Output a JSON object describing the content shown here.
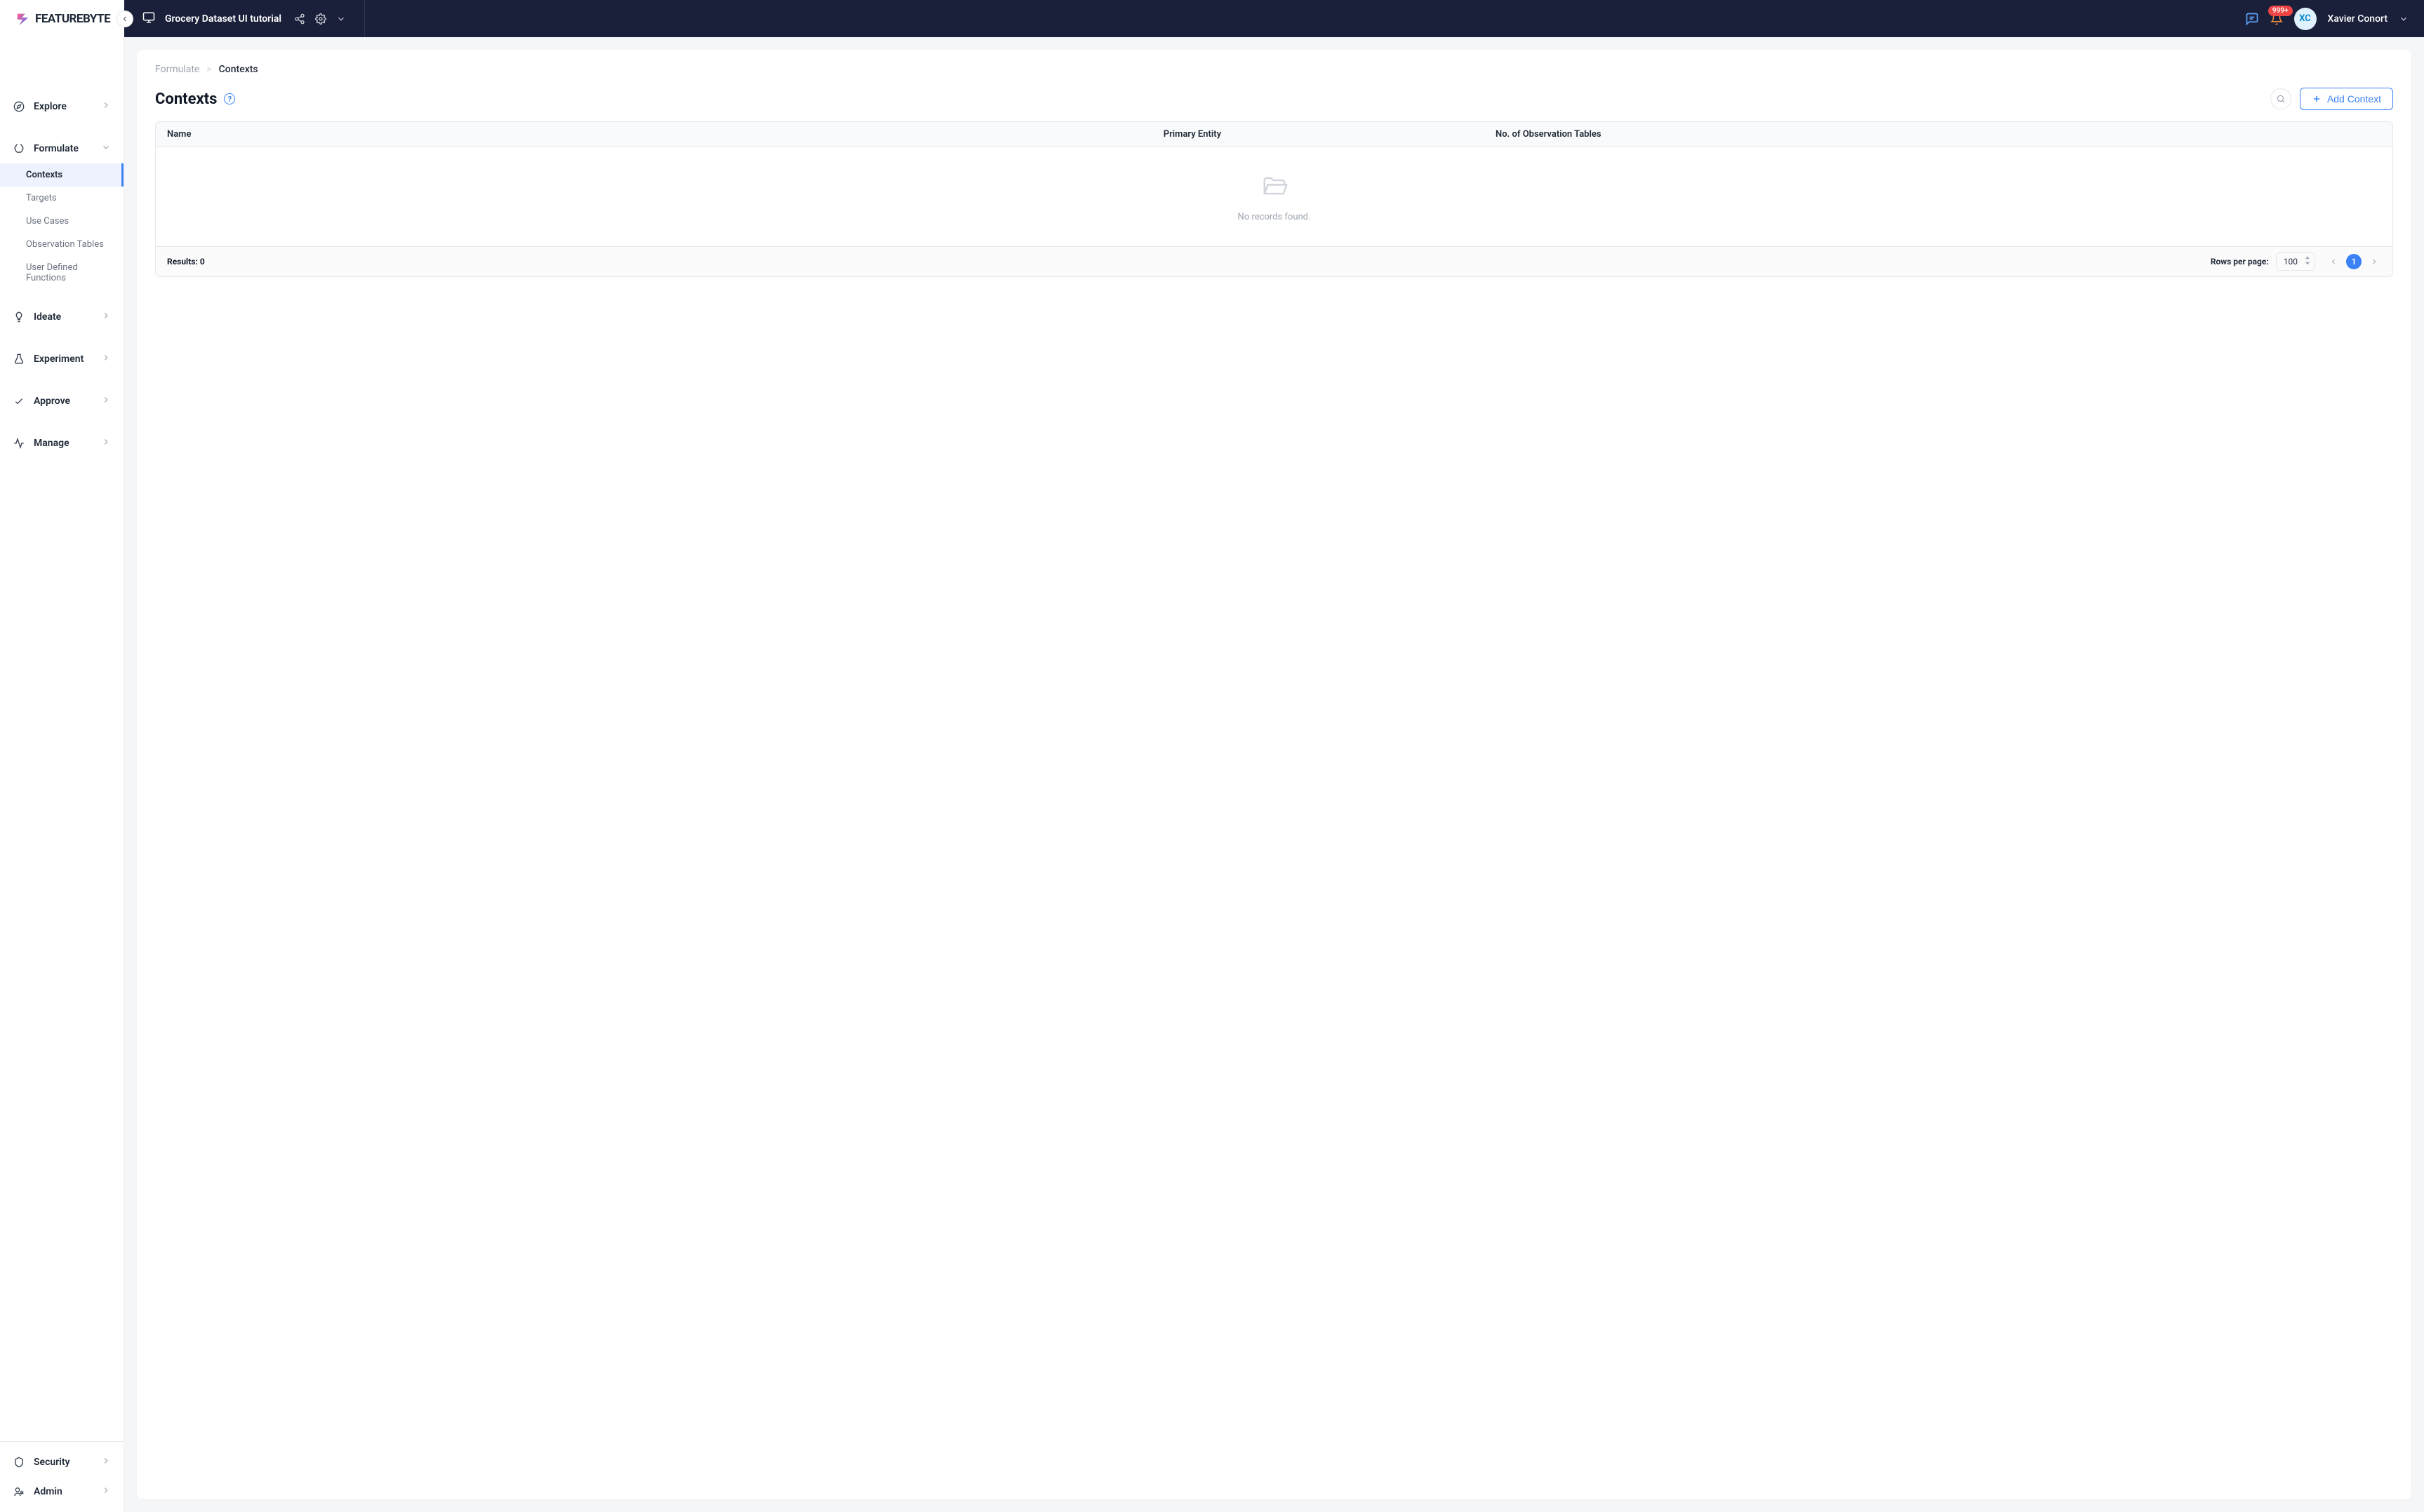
{
  "brand": "FEATUREBYTE",
  "header": {
    "project_name": "Grocery Dataset UI tutorial",
    "notif_badge": "999+",
    "avatar_initials": "XC",
    "user_name": "Xavier Conort"
  },
  "sidebar": {
    "main": [
      {
        "label": "Explore",
        "icon": "compass"
      },
      {
        "label": "Formulate",
        "icon": "brain",
        "expanded": true,
        "children": [
          {
            "label": "Contexts",
            "active": true
          },
          {
            "label": "Targets"
          },
          {
            "label": "Use Cases"
          },
          {
            "label": "Observation Tables"
          },
          {
            "label": "User Defined Functions"
          }
        ]
      },
      {
        "label": "Ideate",
        "icon": "lightbulb"
      },
      {
        "label": "Experiment",
        "icon": "flask"
      },
      {
        "label": "Approve",
        "icon": "check"
      },
      {
        "label": "Manage",
        "icon": "activity"
      }
    ],
    "bottom": [
      {
        "label": "Security",
        "icon": "shield"
      },
      {
        "label": "Admin",
        "icon": "admin"
      }
    ]
  },
  "breadcrumb": {
    "parent": "Formulate",
    "current": "Contexts"
  },
  "page": {
    "title": "Contexts",
    "add_btn": "Add Context"
  },
  "table": {
    "columns": {
      "name": "Name",
      "primary_entity": "Primary Entity",
      "obs_tables": "No. of Observation Tables"
    },
    "empty_text": "No records found.",
    "results_label": "Results: 0",
    "rows_per_page_label": "Rows per page:",
    "rows_per_page_value": "100",
    "current_page": "1"
  }
}
